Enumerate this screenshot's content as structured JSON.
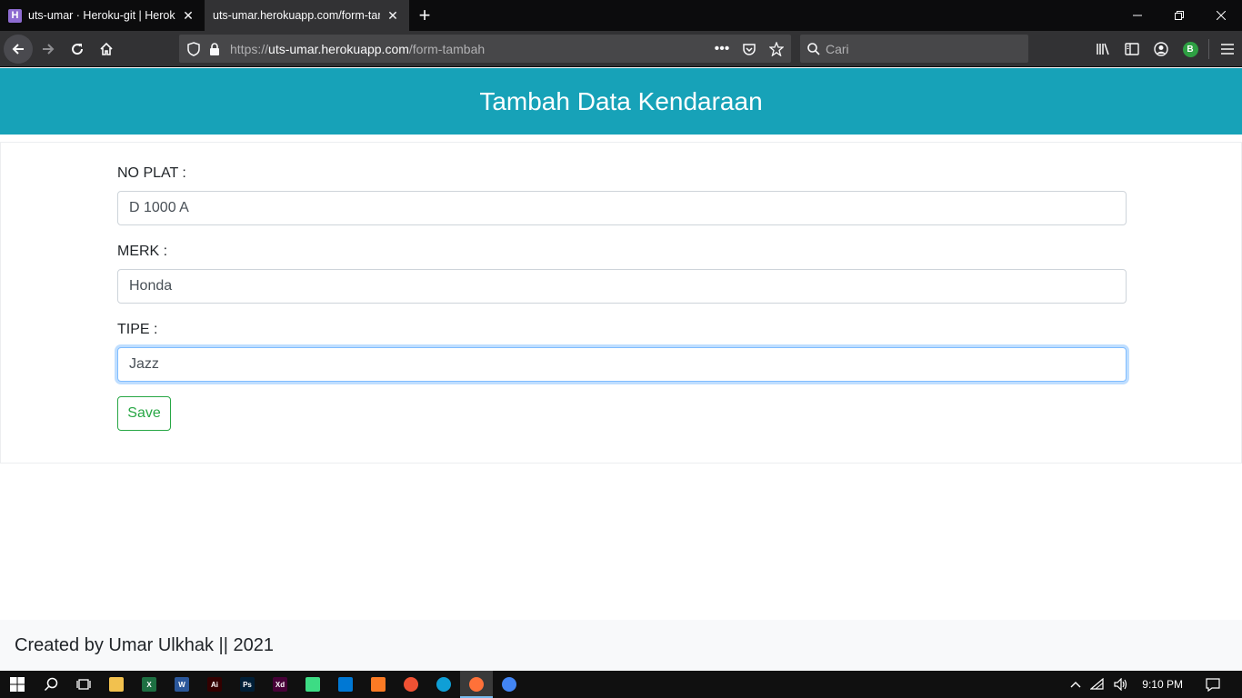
{
  "browser": {
    "tabs": [
      {
        "title": "uts-umar · Heroku-git | Heroku",
        "favicon": "heroku-icon",
        "active": false
      },
      {
        "title": "uts-umar.herokuapp.com/form-tambah",
        "favicon": "",
        "active": true
      }
    ],
    "url": {
      "scheme": "https://",
      "host": "uts-umar.herokuapp.com",
      "path": "/form-tambah"
    },
    "search_placeholder": "Cari",
    "avatar_letter": "B"
  },
  "page": {
    "title": "Tambah Data Kendaraan",
    "header_color": "#17a2b8",
    "fields": [
      {
        "label": "NO PLAT :",
        "value": "D 1000 A"
      },
      {
        "label": "MERK :",
        "value": "Honda"
      },
      {
        "label": "TIPE :",
        "value": "Jazz"
      }
    ],
    "save_label": "Save",
    "footer_text": "Created by Umar Ulkhak || 2021"
  },
  "taskbar": {
    "apps": [
      {
        "name": "file-explorer-icon",
        "label": "",
        "color": "#f2c14e"
      },
      {
        "name": "excel-icon",
        "label": "X",
        "color": "#1d6f42"
      },
      {
        "name": "word-icon",
        "label": "W",
        "color": "#2b579a"
      },
      {
        "name": "illustrator-icon",
        "label": "Ai",
        "color": "#330000"
      },
      {
        "name": "photoshop-icon",
        "label": "Ps",
        "color": "#001e36"
      },
      {
        "name": "xd-icon",
        "label": "Xd",
        "color": "#470137"
      },
      {
        "name": "android-studio-icon",
        "label": "",
        "color": "#3ddc84"
      },
      {
        "name": "vscode-icon",
        "label": "",
        "color": "#0078d4"
      },
      {
        "name": "xampp-icon",
        "label": "",
        "color": "#fb7a24"
      },
      {
        "name": "git-icon",
        "label": "",
        "color": "#f05133"
      },
      {
        "name": "edge-icon",
        "label": "",
        "color": "#0f9fd6"
      },
      {
        "name": "firefox-icon",
        "label": "",
        "color": "#ff7139"
      },
      {
        "name": "chrome-icon",
        "label": "",
        "color": "#4285f4"
      }
    ],
    "clock": "9:10 PM"
  }
}
